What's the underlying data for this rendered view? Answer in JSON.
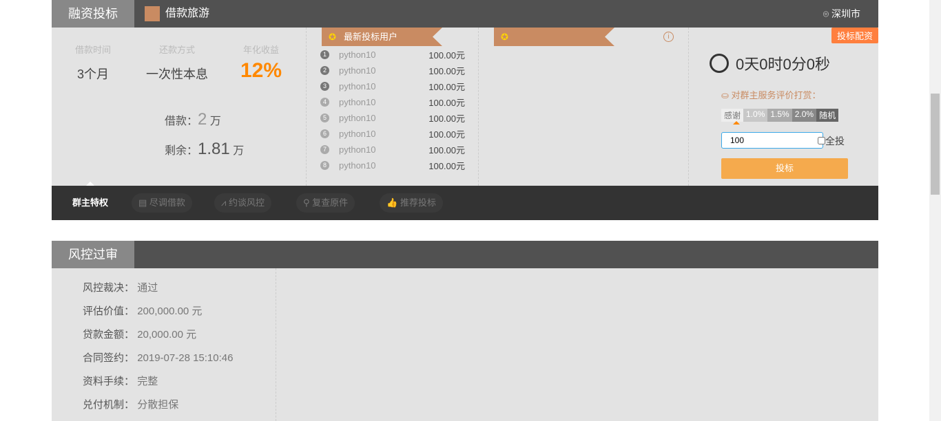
{
  "header": {
    "tab": "融资投标",
    "title": "借款旅游",
    "city": "深圳市"
  },
  "summary": {
    "labels": [
      "借款时间",
      "还款方式",
      "年化收益"
    ],
    "values": [
      "3个月",
      "一次性本息",
      "12%"
    ],
    "loan_label": "借款：",
    "loan_value": "2",
    "loan_unit": "万",
    "remain_label": "剩余：",
    "remain_value": "1.81",
    "remain_unit": "万"
  },
  "investors": {
    "title": "最新投标用户",
    "rows": [
      {
        "n": "1",
        "user": "python10",
        "amount": "100.00元"
      },
      {
        "n": "2",
        "user": "python10",
        "amount": "100.00元"
      },
      {
        "n": "3",
        "user": "python10",
        "amount": "100.00元"
      },
      {
        "n": "4",
        "user": "python10",
        "amount": "100.00元"
      },
      {
        "n": "5",
        "user": "python10",
        "amount": "100.00元"
      },
      {
        "n": "6",
        "user": "python10",
        "amount": "100.00元"
      },
      {
        "n": "7",
        "user": "python10",
        "amount": "100.00元"
      },
      {
        "n": "8",
        "user": "python10",
        "amount": "100.00元"
      }
    ]
  },
  "bid": {
    "badge": "投标配资",
    "countdown": "0天0时0分0秒",
    "reward_label": "对群主服务评价打赏：",
    "options": [
      "感谢",
      "1.0%",
      "1.5%",
      "2.0%",
      "随机"
    ],
    "amount": "100",
    "all_label": "全投",
    "submit": "投标"
  },
  "nav": {
    "items": [
      "群主特权",
      "尽调借款",
      "约谈风控",
      "复查原件",
      "推荐投标"
    ]
  },
  "risk": {
    "title": "风控过审",
    "rows": [
      {
        "k": "风控裁决：",
        "v": "通过"
      },
      {
        "k": "评估价值：",
        "v": "200,000.00 元"
      },
      {
        "k": "贷款金额：",
        "v": "20,000.00 元"
      },
      {
        "k": "合同签约：",
        "v": "2019-07-28 15:10:46"
      },
      {
        "k": "资料手续：",
        "v": "完整"
      },
      {
        "k": "兑付机制：",
        "v": "分散担保"
      }
    ]
  }
}
